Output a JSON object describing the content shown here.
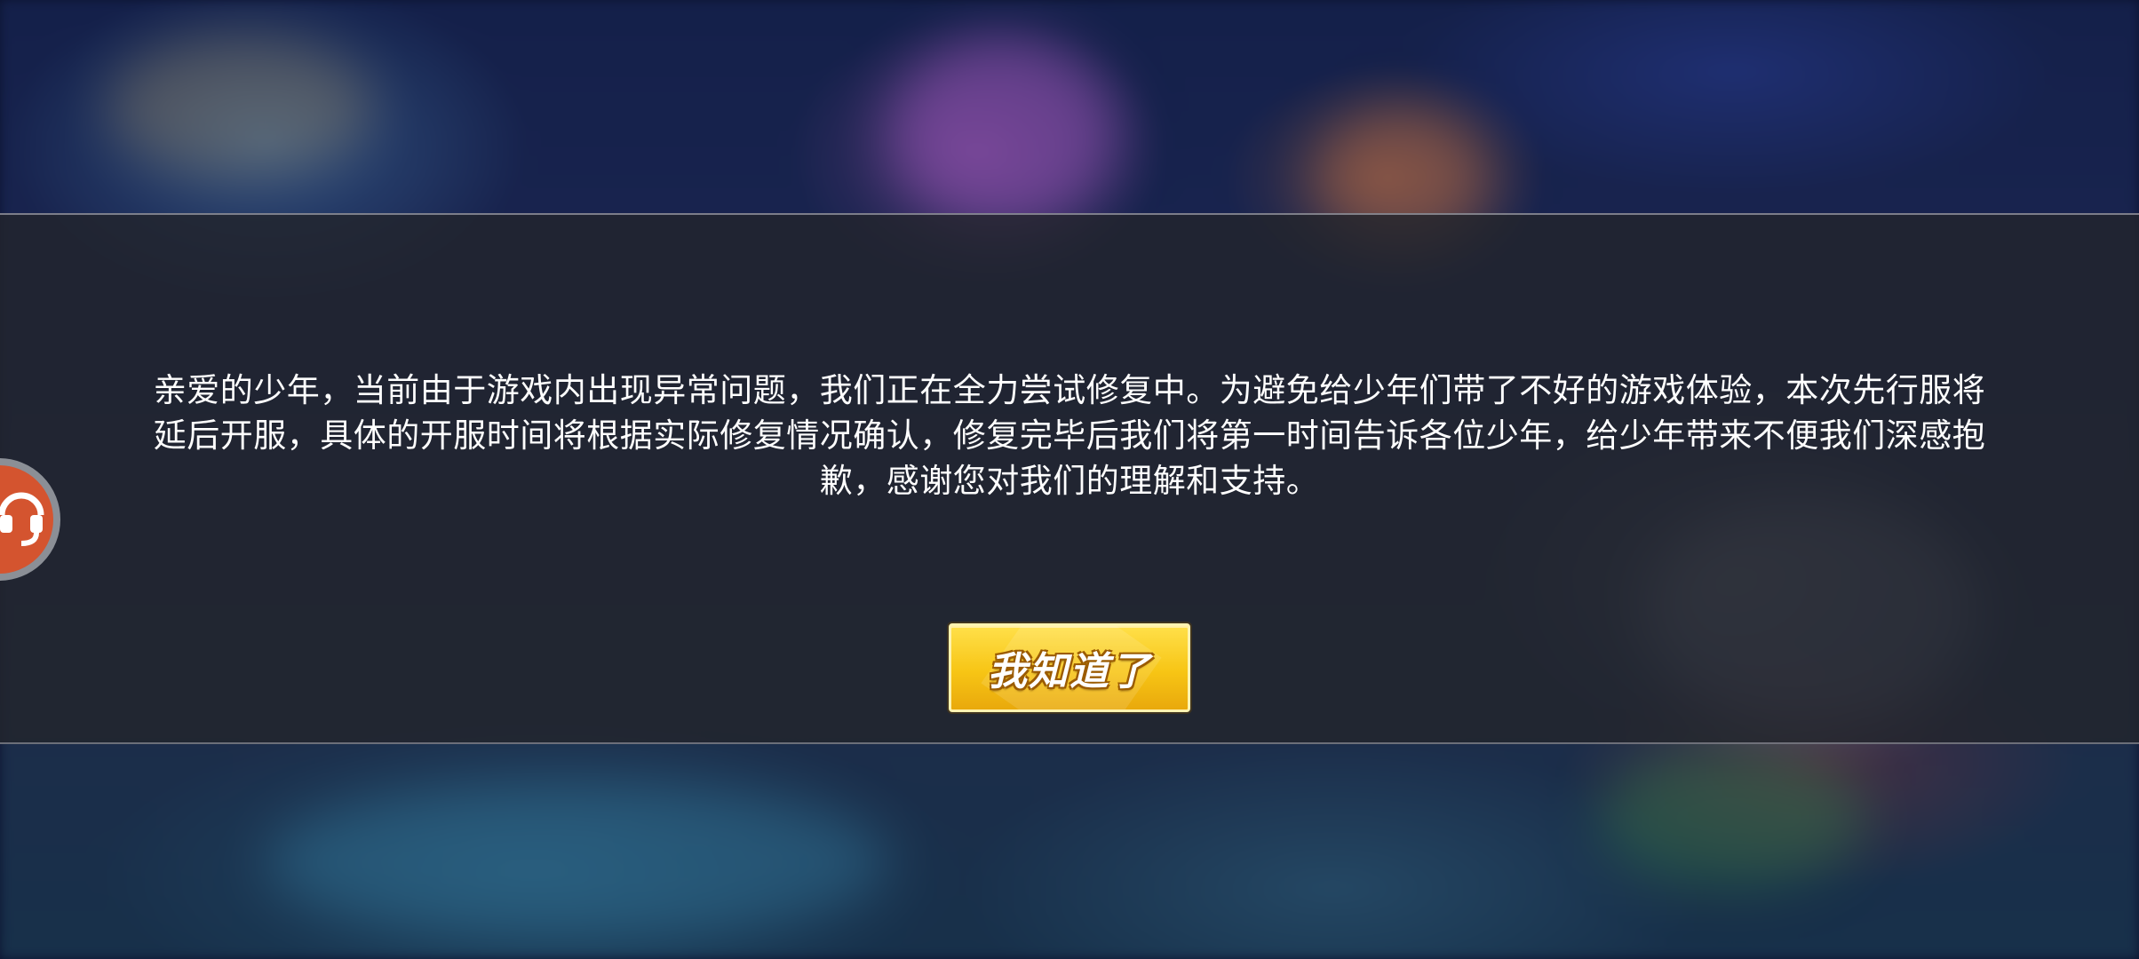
{
  "dialog": {
    "message": "亲爱的少年，当前由于游戏内出现异常问题，我们正在全力尝试修复中。为避免给少年们带了不好的游戏体验，本次先行服将延后开服，具体的开服时间将根据实际修复情况确认，修复完毕后我们将第一时间告诉各位少年，给少年带来不便我们深感抱歉，感谢您对我们的理解和支持。",
    "confirm_label": "我知道了"
  },
  "side_tab": {
    "icon": "customer-service-icon",
    "color": "#d4542f"
  },
  "colors": {
    "button_yellow": "#f7c515",
    "overlay": "#22242c"
  }
}
